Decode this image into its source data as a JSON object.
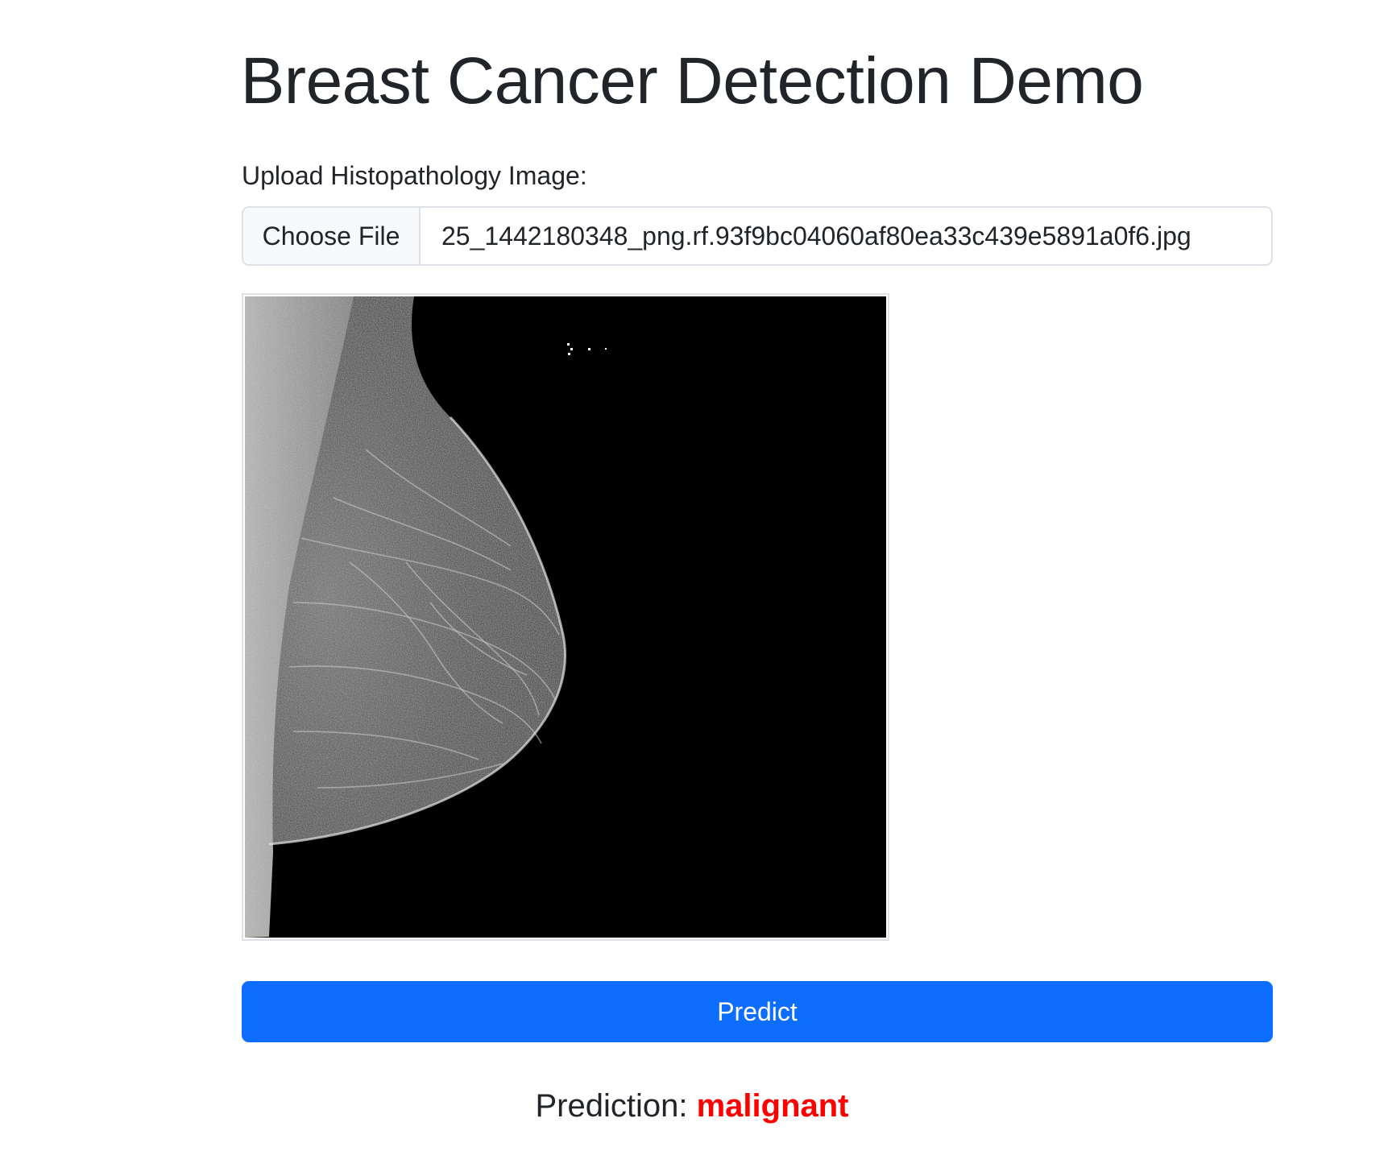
{
  "header": {
    "title": "Breast Cancer Detection Demo"
  },
  "upload": {
    "label": "Upload Histopathology Image:",
    "button_label": "Choose File",
    "file_name": "25_1442180348_png.rf.93f9bc04060af80ea33c439e5891a0f6.jpg"
  },
  "preview": {
    "icon": "mammogram-image"
  },
  "actions": {
    "predict_label": "Predict"
  },
  "result": {
    "prefix": "Prediction:",
    "value": "malignant",
    "value_color": "#ff0000"
  },
  "colors": {
    "primary": "#0d6efd",
    "text": "#212529",
    "border": "#dee2e6"
  }
}
